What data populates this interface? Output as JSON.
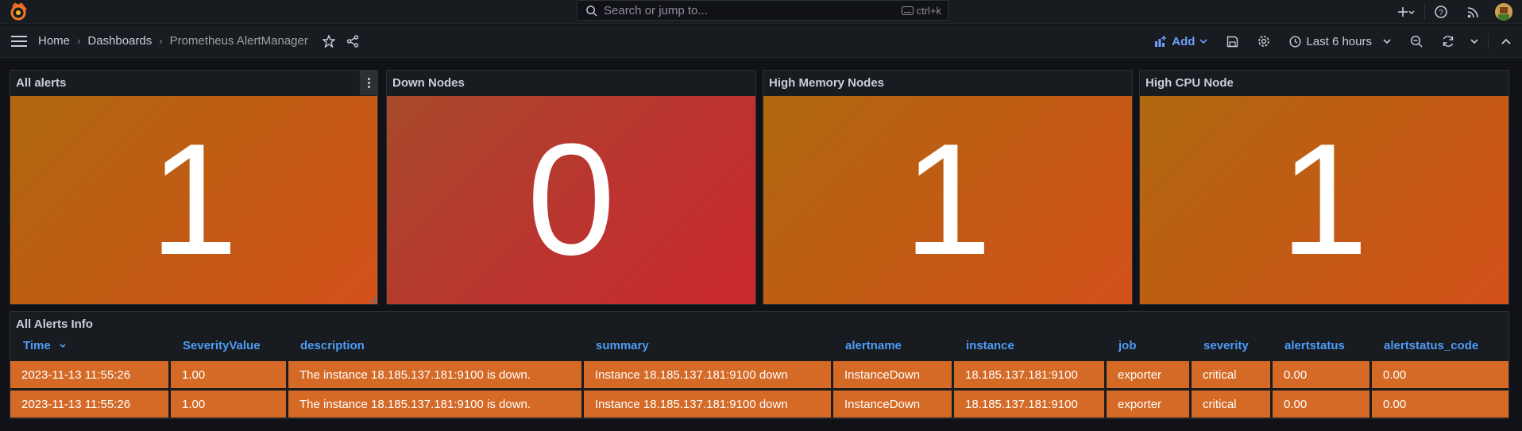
{
  "topbar": {
    "search_placeholder": "Search or jump to...",
    "search_shortcut": "ctrl+k",
    "icons": [
      "grafana-logo-icon",
      "search-icon",
      "keyboard-icon",
      "plus-icon",
      "help-icon",
      "news-icon",
      "user-avatar"
    ]
  },
  "nav": {
    "breadcrumbs": [
      "Home",
      "Dashboards",
      "Prometheus AlertManager"
    ],
    "add_label": "Add",
    "time_range": "Last 6 hours"
  },
  "panels": [
    {
      "title": "All alerts",
      "value": "1",
      "color": "#c25a15"
    },
    {
      "title": "Down Nodes",
      "value": "0",
      "color": "#bb3430"
    },
    {
      "title": "High Memory Nodes",
      "value": "1",
      "color": "#c25a15"
    },
    {
      "title": "High CPU Node",
      "value": "1",
      "color": "#c25a15"
    }
  ],
  "table": {
    "title": "All Alerts Info",
    "columns": [
      "Time",
      "SeverityValue",
      "description",
      "summary",
      "alertname",
      "instance",
      "job",
      "severity",
      "alertstatus",
      "alertstatus_code"
    ],
    "rows": [
      [
        "2023-11-13 11:55:26",
        "1.00",
        "The instance 18.185.137.181:9100 is down.",
        "Instance 18.185.137.181:9100 down",
        "InstanceDown",
        "18.185.137.181:9100",
        "exporter",
        "critical",
        "0.00",
        "0.00"
      ],
      [
        "2023-11-13 11:55:26",
        "1.00",
        "The instance 18.185.137.181:9100 is down.",
        "Instance 18.185.137.181:9100 down",
        "InstanceDown",
        "18.185.137.181:9100",
        "exporter",
        "critical",
        "0.00",
        "0.00"
      ]
    ],
    "row_color": "#d46a26",
    "header_color": "#4e9df8"
  }
}
